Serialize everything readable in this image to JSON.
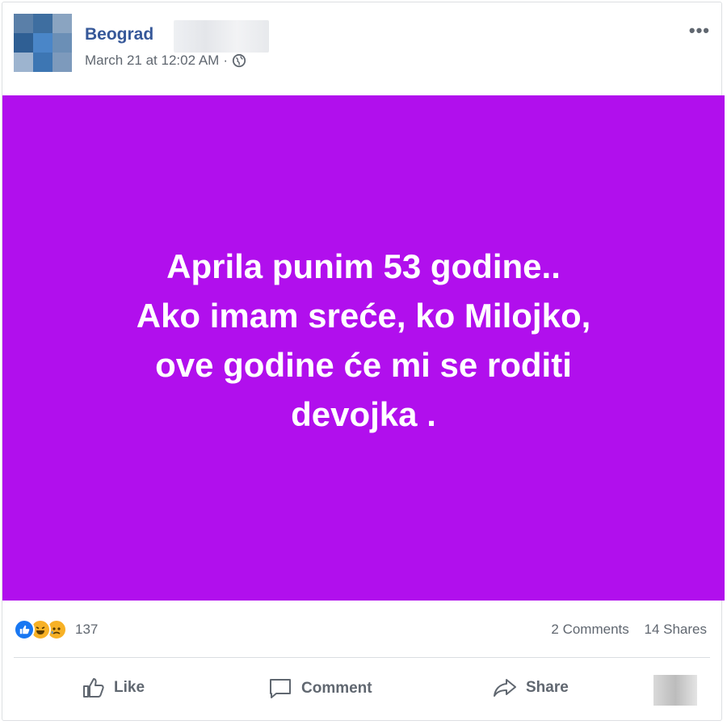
{
  "post": {
    "author": "Beograd",
    "timestamp": "March 21 at 12:02 AM",
    "separator": "·",
    "privacy_icon": "globe-icon",
    "more_icon": "more-options-icon",
    "background_color": "#b10fed",
    "text_lines": [
      "Aprila punim 53 godine..",
      "Ako imam sreće, ko Milojko,",
      "ove godine će mi se roditi",
      "devojka ."
    ]
  },
  "stats": {
    "reactions": [
      "like-reaction-icon",
      "haha-reaction-icon",
      "sad-reaction-icon"
    ],
    "reaction_count": "137",
    "comments": "2 Comments",
    "shares": "14 Shares"
  },
  "actions": {
    "like": "Like",
    "comment": "Comment",
    "share": "Share"
  },
  "colors": {
    "link": "#365899",
    "secondary_text": "#606770",
    "like_blue": "#1877f2",
    "haha_yellow": "#f7b125"
  }
}
